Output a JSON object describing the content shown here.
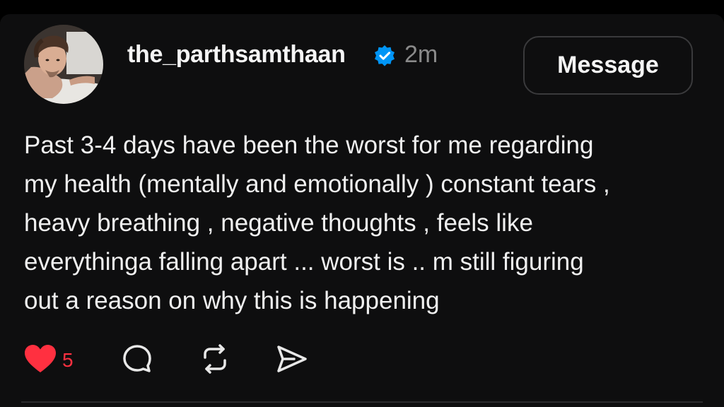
{
  "post": {
    "username": "the_parthsamthaan",
    "verified_icon": "verified-badge-icon",
    "time": "2m",
    "message_button": "Message",
    "text_lines": [
      "Past 3-4 days have been the worst for me regarding",
      "my health (mentally and emotionally ) constant tears ,",
      "heavy breathing , negative thoughts , feels like",
      "everythinga falling apart ... worst is .. m still figuring",
      "out a reason on why this is happening"
    ],
    "like_count": "5"
  },
  "colors": {
    "background": "#0e0e0f",
    "verified_blue": "#0095f6",
    "like_red": "#ff3040",
    "muted_text": "#8a8a8a"
  },
  "icons": [
    "heart-icon",
    "comment-icon",
    "repost-icon",
    "share-icon"
  ]
}
